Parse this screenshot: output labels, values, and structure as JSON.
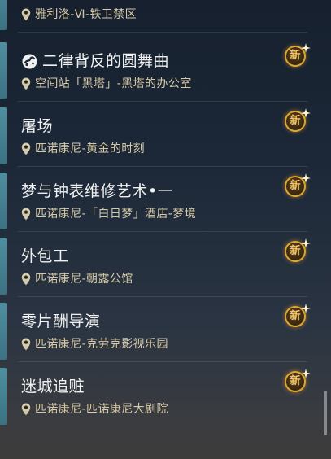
{
  "quests": [
    {
      "title": "",
      "location": "雅利洛-Ⅵ-铁卫禁区",
      "is_new": false,
      "has_icon": false
    },
    {
      "title": "二律背反的圆舞曲",
      "location": "空间站「黑塔」-黑塔的办公室",
      "is_new": true,
      "has_icon": true,
      "icon": "quest-type-icon"
    },
    {
      "title": "屠场",
      "location": "匹诺康尼-黄金的时刻",
      "is_new": true,
      "has_icon": false
    },
    {
      "title": "梦与钟表维修艺术•一",
      "location": "匹诺康尼-「白日梦」酒店-梦境",
      "is_new": true,
      "has_icon": false
    },
    {
      "title": "外包工",
      "location": "匹诺康尼-朝露公馆",
      "is_new": true,
      "has_icon": false
    },
    {
      "title": "零片酬导演",
      "location": "匹诺康尼-克劳克影视乐园",
      "is_new": true,
      "has_icon": false
    },
    {
      "title": "迷城追赃",
      "location": "匹诺康尼-匹诺康尼大剧院",
      "is_new": true,
      "has_icon": false
    }
  ],
  "badge": {
    "new_label": "新"
  },
  "colors": {
    "accent": "#4e8fa0",
    "location_text": "#d6c9a6",
    "badge_gold": "#e0a432"
  },
  "icons": {
    "location": "map-pin-icon",
    "sparkle": "sparkle-icon"
  }
}
